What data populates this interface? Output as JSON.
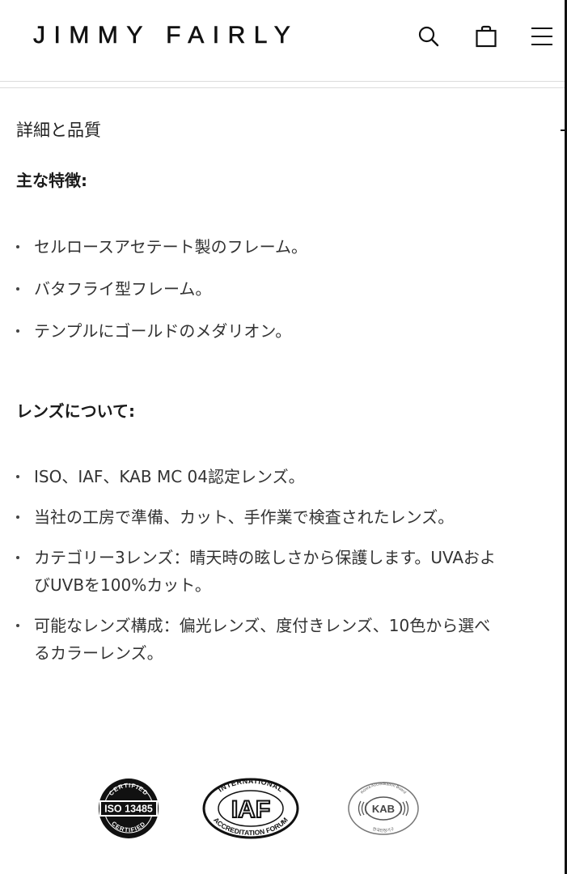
{
  "header": {
    "logo": "JIMMY FAIRLY",
    "icons": {
      "search": "search-icon",
      "bag": "shopping-bag-icon",
      "menu": "hamburger-menu-icon"
    }
  },
  "details": {
    "title": "詳細と品質",
    "features_heading": "主な特徴:",
    "features": [
      "セルロースアセテート製のフレーム。",
      "バタフライ型フレーム。",
      "テンプルにゴールドのメダリオン。"
    ],
    "lenses_heading": "レンズについて:",
    "lenses": [
      "ISO、IAF、KAB MC 04認定レンズ。",
      "当社の工房で準備、カット、手作業で検査されたレンズ。",
      "カテゴリー3レンズ：晴天時の眩しさから保護します。UVAおよびUVBを100%カット。",
      "可能なレンズ構成：偏光レンズ、度付きレンズ、10色から選べるカラーレンズ。"
    ]
  },
  "certifications": {
    "iso": {
      "top": "CERTIFIED",
      "center": "ISO 13485",
      "bottom": "CERTIFIED"
    },
    "iaf": {
      "top": "INTERNATIONAL",
      "center": "IAF",
      "bottom": "ACCREDITATION FORUM"
    },
    "kab": {
      "top": "Korea Accreditation Board",
      "center": "KAB",
      "bottom": "한국인정기구"
    }
  },
  "colors": {
    "text": "#333333",
    "heading": "#1a1a1a",
    "logo": "#111111"
  }
}
